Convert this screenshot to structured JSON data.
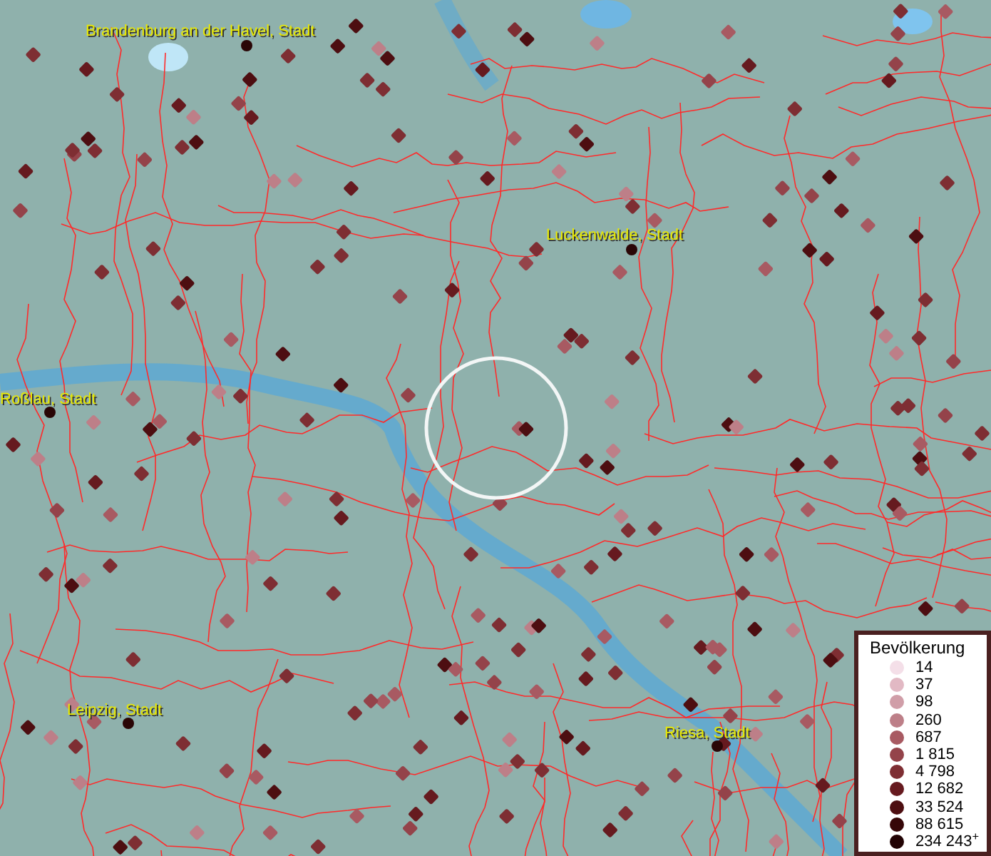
{
  "map": {
    "cities": [
      {
        "name": "Brandenburg an der Havel, Stadt"
      },
      {
        "name": "Luckenwalde, Stadt"
      },
      {
        "name": "Roßlau, Stadt"
      },
      {
        "name": "Leipzig, Stadt"
      },
      {
        "name": "Riesa, Stadt"
      }
    ]
  },
  "legend": {
    "title": "Bevölkerung",
    "entries": [
      {
        "label": "14",
        "color": "#f4dfe8"
      },
      {
        "label": "37",
        "color": "#e2b9c4"
      },
      {
        "label": "98",
        "color": "#d09ea8"
      },
      {
        "label": "260",
        "color": "#bd7f88"
      },
      {
        "label": "687",
        "color": "#a85a62"
      },
      {
        "label": "1 815",
        "color": "#94434a"
      },
      {
        "label": "4 798",
        "color": "#7e2e33"
      },
      {
        "label": "12 682",
        "color": "#661a1f"
      },
      {
        "label": "33 524",
        "color": "#4d0e11"
      },
      {
        "label": "88 615",
        "color": "#360708"
      },
      {
        "label": "234 243$^{+}$",
        "color": "#220304"
      }
    ]
  }
}
